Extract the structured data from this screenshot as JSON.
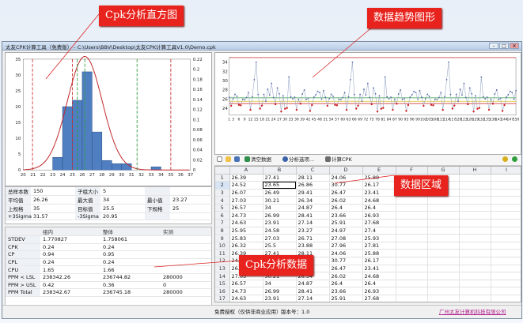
{
  "annotations": {
    "histogram": "Cpk分析直方图",
    "trend": "数据趋势图形",
    "data_area": "数据区域",
    "cpk_data": "Cpk分析数据"
  },
  "window": {
    "title": "太友CPK计算工具（免费版） - C:\\Users\\BBV\\Desktop\\太友CPK计算工具V1.0\\Demo.cpk",
    "minimize": "–",
    "maximize": "□",
    "close": "✕"
  },
  "toolbar": {
    "clear_label": "清空数据",
    "analysis_label": "分析选项...",
    "calc_label": "计算CPK"
  },
  "grid": {
    "columns": [
      "A",
      "B",
      "C",
      "D",
      "E",
      "F",
      "G",
      "H",
      "I"
    ],
    "rows": [
      [
        "26.39",
        "27.41",
        "28.11",
        "24.06",
        "25.88"
      ],
      [
        "24.52",
        "23.65",
        "26.86",
        "30.77",
        "26.17"
      ],
      [
        "26.07",
        "26.49",
        "29.41",
        "26.47",
        "23.41"
      ],
      [
        "27.03",
        "30.21",
        "26.34",
        "26.02",
        "24.68"
      ],
      [
        "26.57",
        "34",
        "24.87",
        "26.4",
        "26.4"
      ],
      [
        "24.73",
        "26.99",
        "28.41",
        "23.66",
        "26.93"
      ],
      [
        "24.63",
        "23.91",
        "27.14",
        "25.91",
        "27.68"
      ],
      [
        "25.95",
        "24.58",
        "23.27",
        "24.97",
        "27.4"
      ],
      [
        "25.83",
        "27.03",
        "26.71",
        "27.08",
        "25.93"
      ],
      [
        "26.32",
        "25.5",
        "23.88",
        "27.96",
        "27.81"
      ],
      [
        "26.39",
        "27.41",
        "28.11",
        "24.06",
        "25.88"
      ],
      [
        "24.52",
        "23.65",
        "26.86",
        "30.77",
        "26.17"
      ],
      [
        "26.07",
        "26.49",
        "29.41",
        "26.47",
        "23.41"
      ],
      [
        "27.03",
        "30.21",
        "26.34",
        "26.02",
        "24.68"
      ],
      [
        "26.57",
        "34",
        "24.87",
        "26.4",
        "26.4"
      ],
      [
        "24.73",
        "26.99",
        "28.41",
        "23.66",
        "26.93"
      ],
      [
        "24.63",
        "23.91",
        "27.14",
        "25.91",
        "27.68"
      ],
      [
        "25.95",
        "24.58",
        "23.27",
        "24.97",
        "27.4"
      ],
      [
        "25.83",
        "27.03",
        "26.71",
        "27.08",
        "25.93"
      ]
    ],
    "row_numbers": [
      "1",
      "2",
      "3",
      "4",
      "5",
      "6",
      "7",
      "8",
      "9",
      "10",
      "11",
      "12",
      "13",
      "14",
      "15",
      "16",
      "17",
      "18",
      "19"
    ]
  },
  "stats_summary": {
    "rows": [
      [
        "总样本数",
        "150",
        "子组大小",
        "5",
        "",
        ""
      ],
      [
        "平均值",
        "26.26",
        "最大值",
        "34",
        "最小值",
        "23.27"
      ],
      [
        "上规格",
        "35",
        "目标值",
        "25.5",
        "下规格",
        "25"
      ],
      [
        "+3Sigma",
        "31.57",
        "-3Sigma",
        "20.95",
        "",
        ""
      ]
    ]
  },
  "stats_detail": {
    "headers": [
      "",
      "组内",
      "整体",
      "实测"
    ],
    "rows": [
      [
        "STDEV",
        "1.770827",
        "1.758061",
        ""
      ],
      [
        "CPK",
        "0.24",
        "0.24",
        ""
      ],
      [
        "CP",
        "0.94",
        "0.95",
        ""
      ],
      [
        "CPL",
        "0.24",
        "0.24",
        ""
      ],
      [
        "CPU",
        "1.65",
        "1.66",
        ""
      ],
      [
        "PPM < LSL",
        "238342.26",
        "236744.82",
        "280000"
      ],
      [
        "PPM > USL",
        "0.42",
        "0.36",
        "0"
      ],
      [
        "PPM Total",
        "238342.67",
        "236745.18",
        "280000"
      ]
    ]
  },
  "status": {
    "license": "免费授权（仅供非商业应用）",
    "version": "版本号：1.0",
    "company": "广州太友计算机科技有限公司"
  },
  "histogram_chart": {
    "x_ticks": [
      "20",
      "21",
      "22",
      "23",
      "24",
      "25",
      "26",
      "27",
      "28",
      "29",
      "30",
      "31",
      "32",
      "33",
      "34",
      "35",
      "36",
      "37"
    ],
    "y_left": [
      "0",
      "5",
      "10",
      "15",
      "20",
      "25",
      "30",
      "35"
    ],
    "y_right": [
      "0",
      "0.02",
      "0.04",
      "0.06",
      "0.08",
      "0.1",
      "0.12",
      "0.14",
      "0.16",
      "0.18",
      "0.2",
      "0.22"
    ],
    "bins": [
      {
        "x0": 23,
        "x1": 24,
        "count": 4
      },
      {
        "x0": 24,
        "x1": 25,
        "count": 20
      },
      {
        "x0": 25,
        "x1": 26,
        "count": 22
      },
      {
        "x0": 26,
        "x1": 27,
        "count": 31
      },
      {
        "x0": 27,
        "x1": 28,
        "count": 12
      },
      {
        "x0": 28,
        "x1": 29,
        "count": 3
      },
      {
        "x0": 29,
        "x1": 30,
        "count": 2
      },
      {
        "x0": 30,
        "x1": 31,
        "count": 2
      },
      {
        "x0": 31,
        "x1": 32,
        "count": 0
      },
      {
        "x0": 32,
        "x1": 33,
        "count": 0
      },
      {
        "x0": 33,
        "x1": 34,
        "count": 1
      }
    ],
    "mean": 26.26,
    "sigma": 1.77,
    "lsl": 25,
    "usl": 35,
    "target": 25.5,
    "minus3s": 20.95,
    "plus3s": 31.57,
    "colors": {
      "bar": "#4f7fc1",
      "curve": "#c0282a",
      "limit": "#cc3333",
      "sigma": "#2f9e3c"
    }
  },
  "trend_chart": {
    "y_ticks": [
      "24",
      "26",
      "28",
      "30",
      "32",
      "34"
    ],
    "x_labels": [
      "1",
      "3",
      "6",
      "9",
      "12",
      "15",
      "18",
      "21",
      "24",
      "27",
      "30",
      "33",
      "36",
      "39",
      "42",
      "45",
      "48",
      "51",
      "54",
      "57",
      "60",
      "63",
      "66",
      "69",
      "72",
      "75",
      "78",
      "81",
      "84",
      "87",
      "90",
      "93",
      "96",
      "99",
      "102",
      "105",
      "108",
      "111",
      "114",
      "117",
      "120",
      "123",
      "126",
      "129",
      "132",
      "135",
      "138",
      "141",
      "144",
      "147",
      "150"
    ],
    "usl": 35,
    "lsl": 25,
    "target": 25.5,
    "mean": 26.26,
    "colors": {
      "line": "#9aa9c8",
      "point": "#5565a8",
      "out": "#d01818",
      "limit": "#d63a3a",
      "center": "#2f9e3c"
    }
  }
}
